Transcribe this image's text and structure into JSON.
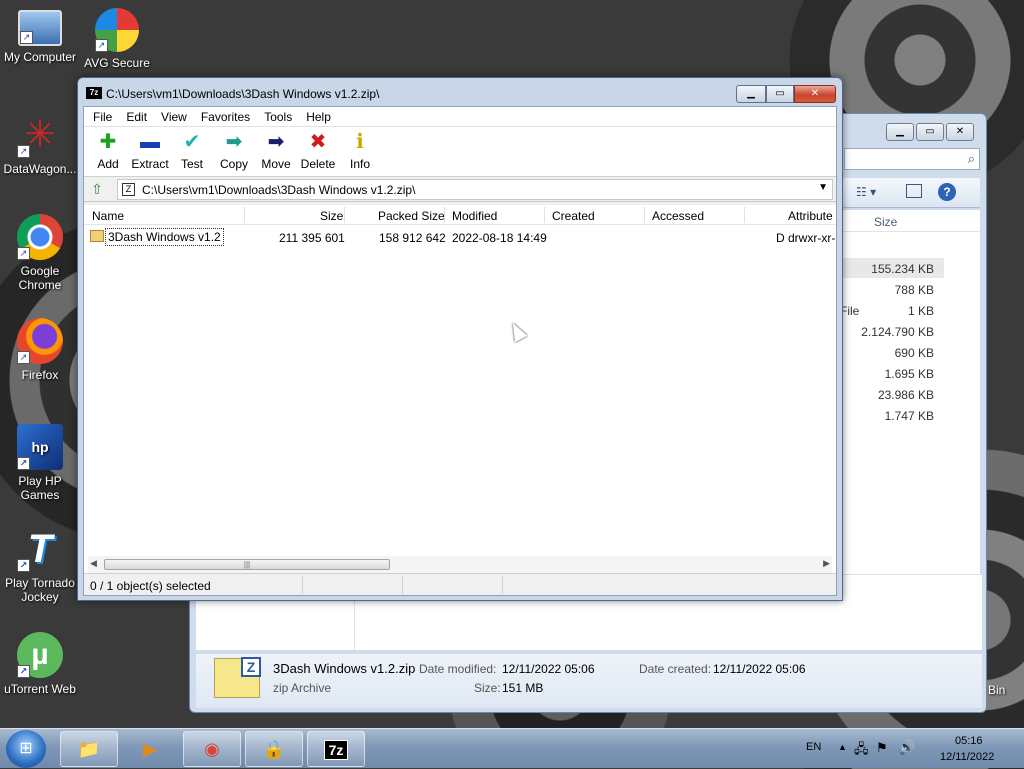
{
  "desktop": {
    "icons": [
      {
        "label": "My Computer",
        "glyph": "🖥"
      },
      {
        "label": "AVG Secure",
        "glyph": "🔒"
      },
      {
        "label": "DataWagon...",
        "glyph": "✳"
      },
      {
        "label": "Google Chrome",
        "glyph": "◉"
      },
      {
        "label": "Firefox",
        "glyph": "🦊"
      },
      {
        "label": "Play HP Games",
        "glyph": "🎮"
      },
      {
        "label": "Play Tornado Jockey",
        "glyph": "T"
      },
      {
        "label": "uTorrent Web",
        "glyph": "µ"
      }
    ]
  },
  "explorer": {
    "column_size": "Size",
    "sizes": [
      "155.234 KB",
      "788 KB",
      "1 KB",
      "2.124.790 KB",
      "690 KB",
      "1.695 KB",
      "23.986 KB",
      "1.747 KB"
    ],
    "partial_type_text": "File",
    "details": {
      "filename": "3Dash Windows v1.2.zip",
      "type": "zip Archive",
      "date_modified_label": "Date modified:",
      "date_modified": "12/11/2022 05:06",
      "date_created_label": "Date created:",
      "date_created": "12/11/2022 05:06",
      "size_label": "Size:",
      "size": "151 MB"
    },
    "recycle_bin_partial": "Bin"
  },
  "zip_window": {
    "title": "C:\\Users\\vm1\\Downloads\\3Dash Windows v1.2.zip\\",
    "app_icon": "7z",
    "menu": [
      "File",
      "Edit",
      "View",
      "Favorites",
      "Tools",
      "Help"
    ],
    "toolbar": [
      {
        "label": "Add",
        "glyph": "✚",
        "color": "#1aa31a"
      },
      {
        "label": "Extract",
        "glyph": "▬",
        "color": "#1a3fb5"
      },
      {
        "label": "Test",
        "glyph": "✔",
        "color": "#1fb4b4"
      },
      {
        "label": "Copy",
        "glyph": "➡",
        "color": "#1f9d8a"
      },
      {
        "label": "Move",
        "glyph": "➡",
        "color": "#16206b"
      },
      {
        "label": "Delete",
        "glyph": "✖",
        "color": "#d11a1a"
      },
      {
        "label": "Info",
        "glyph": "ℹ",
        "color": "#c9a800"
      }
    ],
    "address": "C:\\Users\\vm1\\Downloads\\3Dash Windows v1.2.zip\\",
    "columns": [
      "Name",
      "Size",
      "Packed Size",
      "Modified",
      "Created",
      "Accessed",
      "Attribute"
    ],
    "rows": [
      {
        "name": "3Dash Windows v1.2",
        "size": "211 395 601",
        "packed": "158 912 642",
        "modified": "2022-08-18 14:49",
        "created": "",
        "accessed": "",
        "attributes": "D drwxr-xr-"
      }
    ],
    "status": "0 / 1 object(s) selected"
  },
  "taskbar": {
    "language": "EN",
    "time": "05:16",
    "date": "12/11/2022",
    "pinned": [
      {
        "name": "explorer",
        "glyph": "📁"
      },
      {
        "name": "media-player",
        "glyph": "▶"
      },
      {
        "name": "chrome",
        "glyph": "◉"
      },
      {
        "name": "avg",
        "glyph": "🔒"
      },
      {
        "name": "7zip",
        "glyph": "7z"
      }
    ]
  }
}
